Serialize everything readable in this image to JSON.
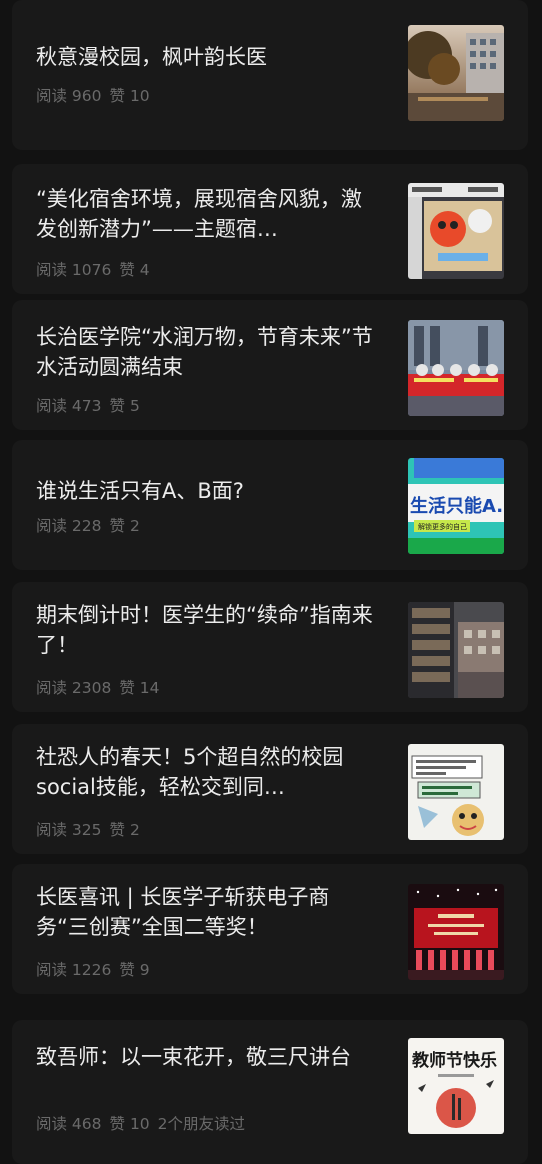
{
  "articles": [
    {
      "title": "秋意漫校园，枫叶韵长医",
      "reads": "阅读 960",
      "likes": "赞 10",
      "friends": "",
      "thumb_icon": "campus-autumn-photo"
    },
    {
      "title": "“美化宿舍环境，展现宿舍风貌，激发创新潜力”——主题宿…",
      "reads": "阅读 1076",
      "likes": "赞 4",
      "friends": "",
      "thumb_icon": "dorm-poster-image"
    },
    {
      "title": "长治医学院“水润万物，节育未来”节水活动圆满结束",
      "reads": "阅读 473",
      "likes": "赞 5",
      "friends": "",
      "thumb_icon": "water-event-photo"
    },
    {
      "title": "谁说生活只有A、B面?",
      "reads": "阅读 228",
      "likes": "赞 2",
      "friends": "",
      "thumb_icon": "life-cover-image",
      "thumb_text": "生活只能A.",
      "thumb_subtext": "解锁更多的自己"
    },
    {
      "title": "期末倒计时！医学生的“续命”指南来了！",
      "reads": "阅读 2308",
      "likes": "赞 14",
      "friends": "",
      "thumb_icon": "library-photo"
    },
    {
      "title": "社恐人的春天！5个超自然的校园social技能，轻松交到同…",
      "reads": "阅读 325",
      "likes": "赞 2",
      "friends": "",
      "thumb_icon": "comic-image"
    },
    {
      "title": "长医喜讯 | 长医学子斩获电子商务“三创赛”全国二等奖！",
      "reads": "阅读 1226",
      "likes": "赞 9",
      "friends": "",
      "thumb_icon": "award-stage-photo"
    },
    {
      "title": "致吾师：以一束花开，敬三尺讲台",
      "reads": "阅读 468",
      "likes": "赞 10",
      "friends": "2个朋友读过",
      "thumb_icon": "teachers-day-image",
      "thumb_text": "教师节快乐"
    }
  ],
  "colors": {
    "background": "#121212",
    "card": "#191919",
    "title": "#ececec",
    "meta": "#6a6a6a"
  }
}
